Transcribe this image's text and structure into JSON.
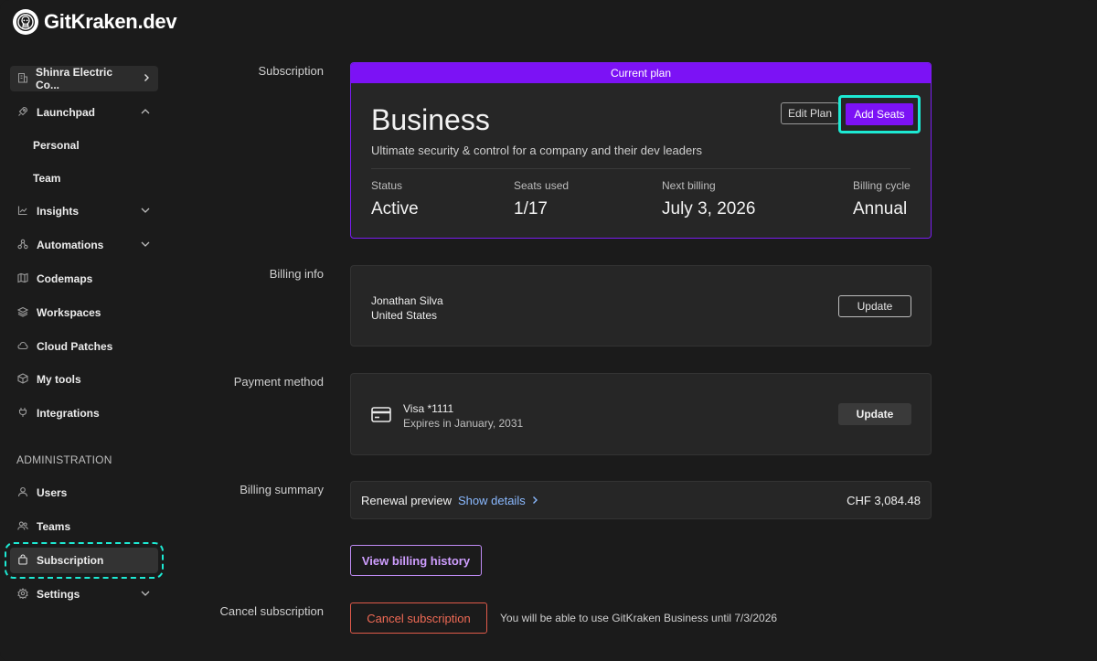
{
  "brand": {
    "name": "GitKraken.dev"
  },
  "sidebar": {
    "org": "Shinra Electric Co...",
    "items": [
      {
        "label": "Launchpad",
        "icon": "rocket-icon"
      },
      {
        "label": "Personal"
      },
      {
        "label": "Team"
      },
      {
        "label": "Insights",
        "icon": "chart-line-icon"
      },
      {
        "label": "Automations",
        "icon": "automation-icon"
      },
      {
        "label": "Codemaps",
        "icon": "map-icon"
      },
      {
        "label": "Workspaces",
        "icon": "layers-icon"
      },
      {
        "label": "Cloud Patches",
        "icon": "cloud-icon"
      },
      {
        "label": "My tools",
        "icon": "box-icon"
      },
      {
        "label": "Integrations",
        "icon": "plug-icon"
      }
    ],
    "admin_label": "ADMINISTRATION",
    "admin_items": [
      {
        "label": "Users",
        "icon": "user-icon"
      },
      {
        "label": "Teams",
        "icon": "users-icon"
      },
      {
        "label": "Subscription",
        "icon": "bag-icon"
      },
      {
        "label": "Settings",
        "icon": "gear-icon"
      }
    ]
  },
  "subscription": {
    "section_label": "Subscription",
    "banner": "Current plan",
    "plan_name": "Business",
    "plan_description": "Ultimate security & control for a company and their dev leaders",
    "edit_label": "Edit Plan",
    "add_seats_label": "Add Seats",
    "stats": [
      {
        "label": "Status",
        "value": "Active"
      },
      {
        "label": "Seats used",
        "value": "1/17"
      },
      {
        "label": "Next billing",
        "value": "July 3, 2026"
      },
      {
        "label": "Billing cycle",
        "value": "Annual"
      }
    ]
  },
  "billing_info": {
    "section_label": "Billing info",
    "name": "Jonathan Silva",
    "country": "United States",
    "update_label": "Update"
  },
  "payment": {
    "section_label": "Payment method",
    "card": "Visa *1111",
    "expires": "Expires in January, 2031",
    "update_label": "Update"
  },
  "summary": {
    "section_label": "Billing summary",
    "renewal_label": "Renewal preview",
    "details_label": "Show details",
    "amount": "CHF 3,084.48",
    "history_label": "View billing history"
  },
  "cancel": {
    "section_label": "Cancel subscription",
    "button_label": "Cancel subscription",
    "note": "You will be able to use GitKraken Business until 7/3/2026"
  },
  "colors": {
    "accent": "#7c12f5",
    "highlight": "#1de9d3",
    "danger": "#f06a55",
    "link": "#8ab9ff"
  }
}
